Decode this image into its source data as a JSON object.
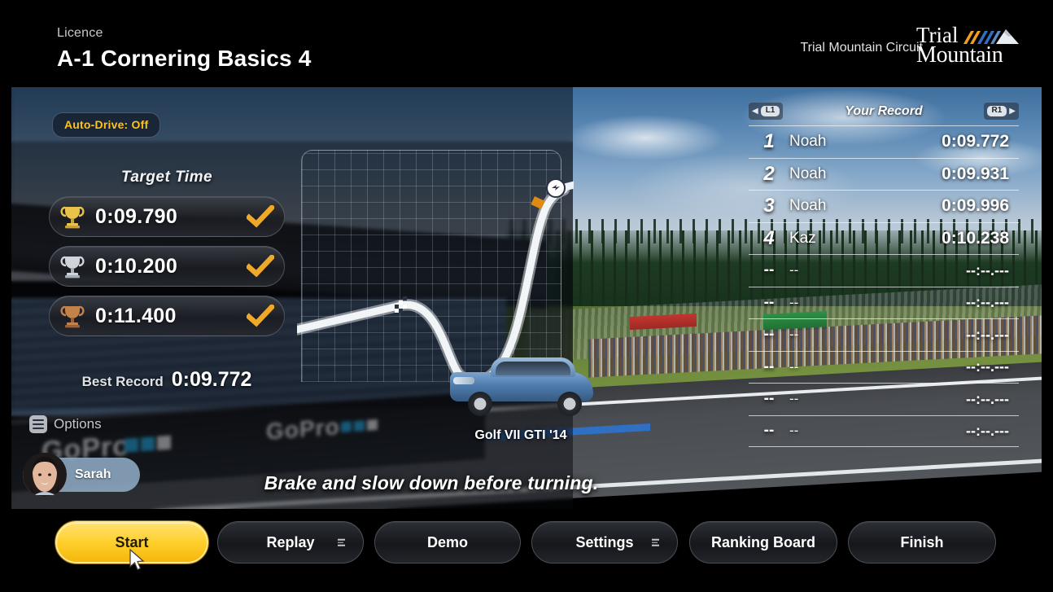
{
  "header": {
    "licence_label": "Licence",
    "title": "A-1 Cornering Basics 4",
    "circuit": "Trial Mountain Circuit",
    "logo_line1": "Trial",
    "logo_line2": "Mountain",
    "logo_accent_orange": "#f0a020",
    "logo_accent_blue": "#2f6fc4"
  },
  "hud": {
    "auto_drive": "Auto-Drive: Off",
    "auto_drive_color": "#ffc21a",
    "hint": "Brake and slow down before turning.",
    "car_name": "Golf VII GTI '14",
    "options_label": "Options",
    "options_icon": "list-menu-icon",
    "driver_name": "Sarah"
  },
  "target_time": {
    "title": "Target Time",
    "rows": [
      {
        "medal": "gold",
        "medal_color": "#e8c24a",
        "time": "0:09.790",
        "achieved": true,
        "check_color": "#f0a828"
      },
      {
        "medal": "silver",
        "medal_color": "#cfd4da",
        "time": "0:10.200",
        "achieved": true,
        "check_color": "#f0a828"
      },
      {
        "medal": "bronze",
        "medal_color": "#c5814a",
        "time": "0:11.400",
        "achieved": true,
        "check_color": "#f0a828"
      }
    ],
    "best_record_label": "Best Record",
    "best_record_value": "0:09.772"
  },
  "record_board": {
    "title": "Your Record",
    "prev_button": "L1",
    "next_button": "R1",
    "empty_rank": "--",
    "empty_name": "--",
    "empty_time": "--:--.---",
    "rows": [
      {
        "rank": "1",
        "name": "Noah",
        "time": "0:09.772"
      },
      {
        "rank": "2",
        "name": "Noah",
        "time": "0:09.931"
      },
      {
        "rank": "3",
        "name": "Noah",
        "time": "0:09.996"
      },
      {
        "rank": "4",
        "name": "Kaz",
        "time": "0:10.238"
      },
      {
        "rank": "--",
        "name": "--",
        "time": "--:--.---"
      },
      {
        "rank": "--",
        "name": "--",
        "time": "--:--.---"
      },
      {
        "rank": "--",
        "name": "--",
        "time": "--:--.---"
      },
      {
        "rank": "--",
        "name": "--",
        "time": "--:--.---"
      },
      {
        "rank": "--",
        "name": "--",
        "time": "--:--.---"
      },
      {
        "rank": "--",
        "name": "--",
        "time": "--:--.---"
      }
    ]
  },
  "buttons": [
    {
      "label": "Start",
      "highlighted": true,
      "has_menu": false
    },
    {
      "label": "Replay",
      "highlighted": false,
      "has_menu": true
    },
    {
      "label": "Demo",
      "highlighted": false,
      "has_menu": false
    },
    {
      "label": "Settings",
      "highlighted": false,
      "has_menu": true
    },
    {
      "label": "Ranking Board",
      "highlighted": false,
      "has_menu": false
    },
    {
      "label": "Finish",
      "highlighted": false,
      "has_menu": false
    }
  ],
  "theme": {
    "accent_yellow": "#ffd12e",
    "background": "#000000",
    "panel_border": "#4a4e56"
  }
}
